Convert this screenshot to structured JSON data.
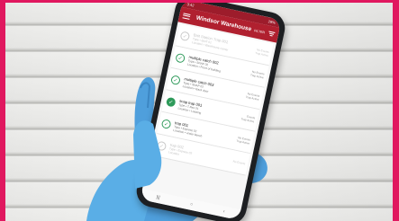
{
  "app": {
    "title": "Windsor Warehouse",
    "filter_label": "FILTER",
    "status_time": "3:42",
    "status_battery": "28%"
  },
  "items": [
    {
      "name": "Bait Station Trap 001",
      "sub": "Type • BAIT 01",
      "loc": "Location • Warehouse corner",
      "meta1": "No Events",
      "meta2": "Trap Active",
      "state": "faded"
    },
    {
      "name": "multiple catch 002",
      "sub": "Type • SNAP 02",
      "loc": "Location • Front of building",
      "meta1": "No Events",
      "meta2": "Trap Active",
      "state": "outline"
    },
    {
      "name": "multiple catch 003",
      "sub": "Type • SNAP 02",
      "loc": "Location • Back door",
      "meta1": "No Events",
      "meta2": "Trap Active",
      "state": "outline"
    },
    {
      "name": "snap trap 001",
      "sub": "Type • T-Rex 01",
      "loc": "Location • Loading",
      "meta1": "Events",
      "meta2": "Trap Active",
      "state": "filled"
    },
    {
      "name": "trap 001",
      "sub": "Type • Express 02",
      "loc": "Location • under bench",
      "meta1": "No Events",
      "meta2": "Trap Active",
      "state": "outline"
    },
    {
      "name": "trap 002",
      "sub": "Type • Express 02",
      "loc": "Location",
      "meta1": "No Events",
      "meta2": "",
      "state": "faded"
    }
  ],
  "colors": {
    "appbar": "#b0202f",
    "check": "#2e9a5a",
    "frame": "#e0185f",
    "glove": "#5aaee6"
  }
}
